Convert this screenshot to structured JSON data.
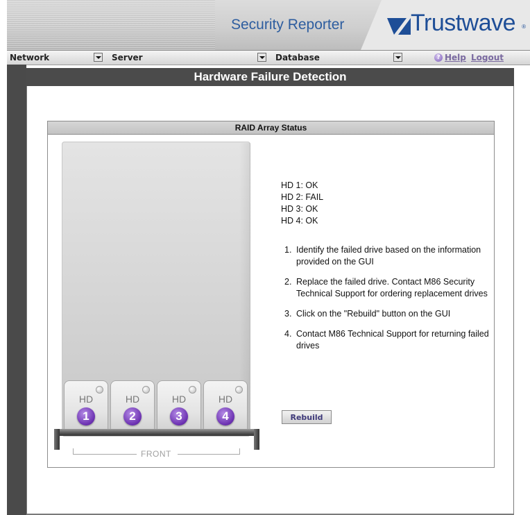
{
  "header": {
    "app_title": "Security Reporter",
    "logo_text": "Trustwave",
    "logo_reg": "®",
    "brand_color": "#1e4e97"
  },
  "navbar": {
    "menus": [
      {
        "label": "Network"
      },
      {
        "label": "Server"
      },
      {
        "label": "Database"
      }
    ],
    "help_link": "Help",
    "logout_link": "Logout"
  },
  "page": {
    "title": "Hardware Failure Detection"
  },
  "raid": {
    "panel_title": "RAID Array Status",
    "statuses": [
      "HD 1: OK",
      "HD 2: FAIL",
      "HD 3: OK",
      "HD 4: OK"
    ],
    "bays": [
      {
        "label": "HD",
        "number": "1"
      },
      {
        "label": "HD",
        "number": "2"
      },
      {
        "label": "HD",
        "number": "3"
      },
      {
        "label": "HD",
        "number": "4"
      }
    ],
    "front_label": "FRONT",
    "steps": [
      {
        "num": "1.",
        "text": "Identify the failed drive based on the information provided on the GUI"
      },
      {
        "num": "2.",
        "text": "Replace the failed drive.  Contact M86 Security Technical Support for ordering replacement drives"
      },
      {
        "num": "3.",
        "text": "Click on the \"Rebuild\" button on the GUI"
      },
      {
        "num": "4.",
        "text": "Contact M86 Technical Support for returning failed drives"
      }
    ],
    "rebuild_button": "Rebuild",
    "bay_number_color": "#6a2fb0"
  }
}
